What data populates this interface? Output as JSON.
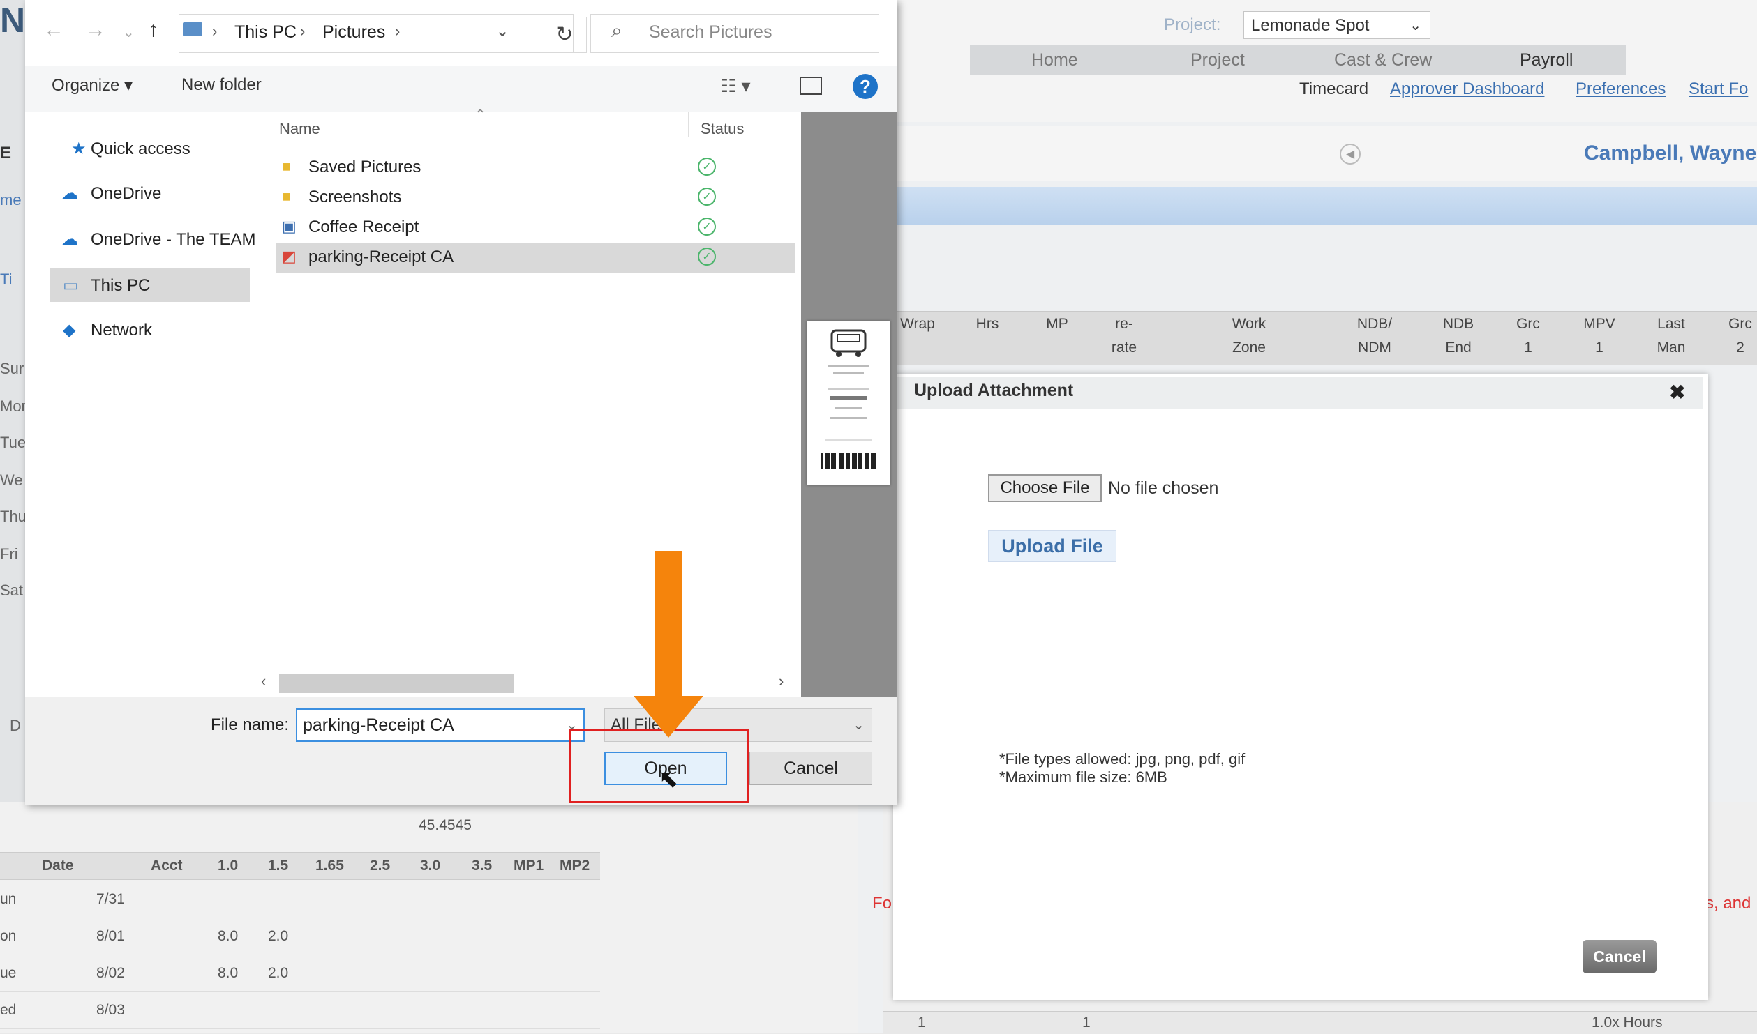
{
  "web": {
    "logo_letter": "N",
    "project_label": "Project:",
    "project_value": "Lemonade Spot",
    "nav_tabs": [
      "Home",
      "Project",
      "Cast & Crew",
      "Payroll"
    ],
    "subnav": {
      "timecard": "Timecard",
      "approver_dashboard": "Approver Dashboard",
      "preferences": "Preferences",
      "start_form": "Start Fo"
    },
    "employee_name": "Campbell, Wayne",
    "grid_headers": [
      {
        "top": "",
        "bottom": "Wrap"
      },
      {
        "top": "",
        "bottom": "Hrs"
      },
      {
        "top": "",
        "bottom": "MP"
      },
      {
        "top": "re-",
        "bottom": "rate"
      },
      {
        "top": "Work",
        "bottom": "Zone"
      },
      {
        "top": "NDB/",
        "bottom": "NDM"
      },
      {
        "top": "NDB",
        "bottom": "End"
      },
      {
        "top": "Grc",
        "bottom": "1"
      },
      {
        "top": "MPV",
        "bottom": "1"
      },
      {
        "top": "Last",
        "bottom": "Man"
      },
      {
        "top": "Grc",
        "bottom": "2"
      }
    ],
    "left_strip": {
      "e": "E",
      "me": "me",
      "ti": "Ti",
      "days": [
        "Sur",
        "Mor",
        "Tue",
        "We",
        "Thu",
        "Fri",
        "Sat"
      ],
      "d": "D"
    },
    "bottom_table": {
      "total": "45.4545",
      "headers": [
        "Date",
        "Acct",
        "1.0",
        "1.5",
        "1.65",
        "2.5",
        "3.0",
        "3.5",
        "MP1",
        "MP2"
      ],
      "rows": [
        {
          "day": "un",
          "date": "7/31",
          "v10": "",
          "v15": ""
        },
        {
          "day": "on",
          "date": "8/01",
          "v10": "8.0",
          "v15": "2.0"
        },
        {
          "day": "ue",
          "date": "8/02",
          "v10": "8.0",
          "v15": "2.0"
        },
        {
          "day": "ed",
          "date": "8/03",
          "v10": "",
          "v15": ""
        }
      ]
    },
    "bottom_right": {
      "fo": "Fo",
      "s_and": "s, and",
      "c1": "1",
      "c2": "1",
      "hours": "1.0x Hours"
    }
  },
  "modal": {
    "title": "Upload Attachment",
    "close": "✖",
    "choose_file": "Choose File",
    "no_file": "No file chosen",
    "upload": "Upload File",
    "note1": "*File types allowed: jpg, png, pdf, gif",
    "note2": "*Maximum file size: 6MB",
    "cancel": "Cancel"
  },
  "dialog": {
    "path": [
      "This PC",
      "Pictures"
    ],
    "search_placeholder": "Search Pictures",
    "organize": "Organize ▾",
    "new_folder": "New folder",
    "nav": [
      "Quick access",
      "OneDrive",
      "OneDrive - The TEAM",
      "This PC",
      "Network"
    ],
    "columns": {
      "name": "Name",
      "status": "Status"
    },
    "files": [
      "Saved Pictures",
      "Screenshots",
      "Coffee Receipt",
      "parking-Receipt CA"
    ],
    "file_name_label": "File name:",
    "file_name_value": "parking-Receipt CA",
    "filter": "All Files",
    "open": "Open",
    "cancel": "Cancel"
  },
  "colors": {
    "accent_blue": "#3c8fe0",
    "annotation_orange": "#f5840c",
    "annotation_red": "#e02020",
    "link_blue": "#3a6fb0"
  }
}
